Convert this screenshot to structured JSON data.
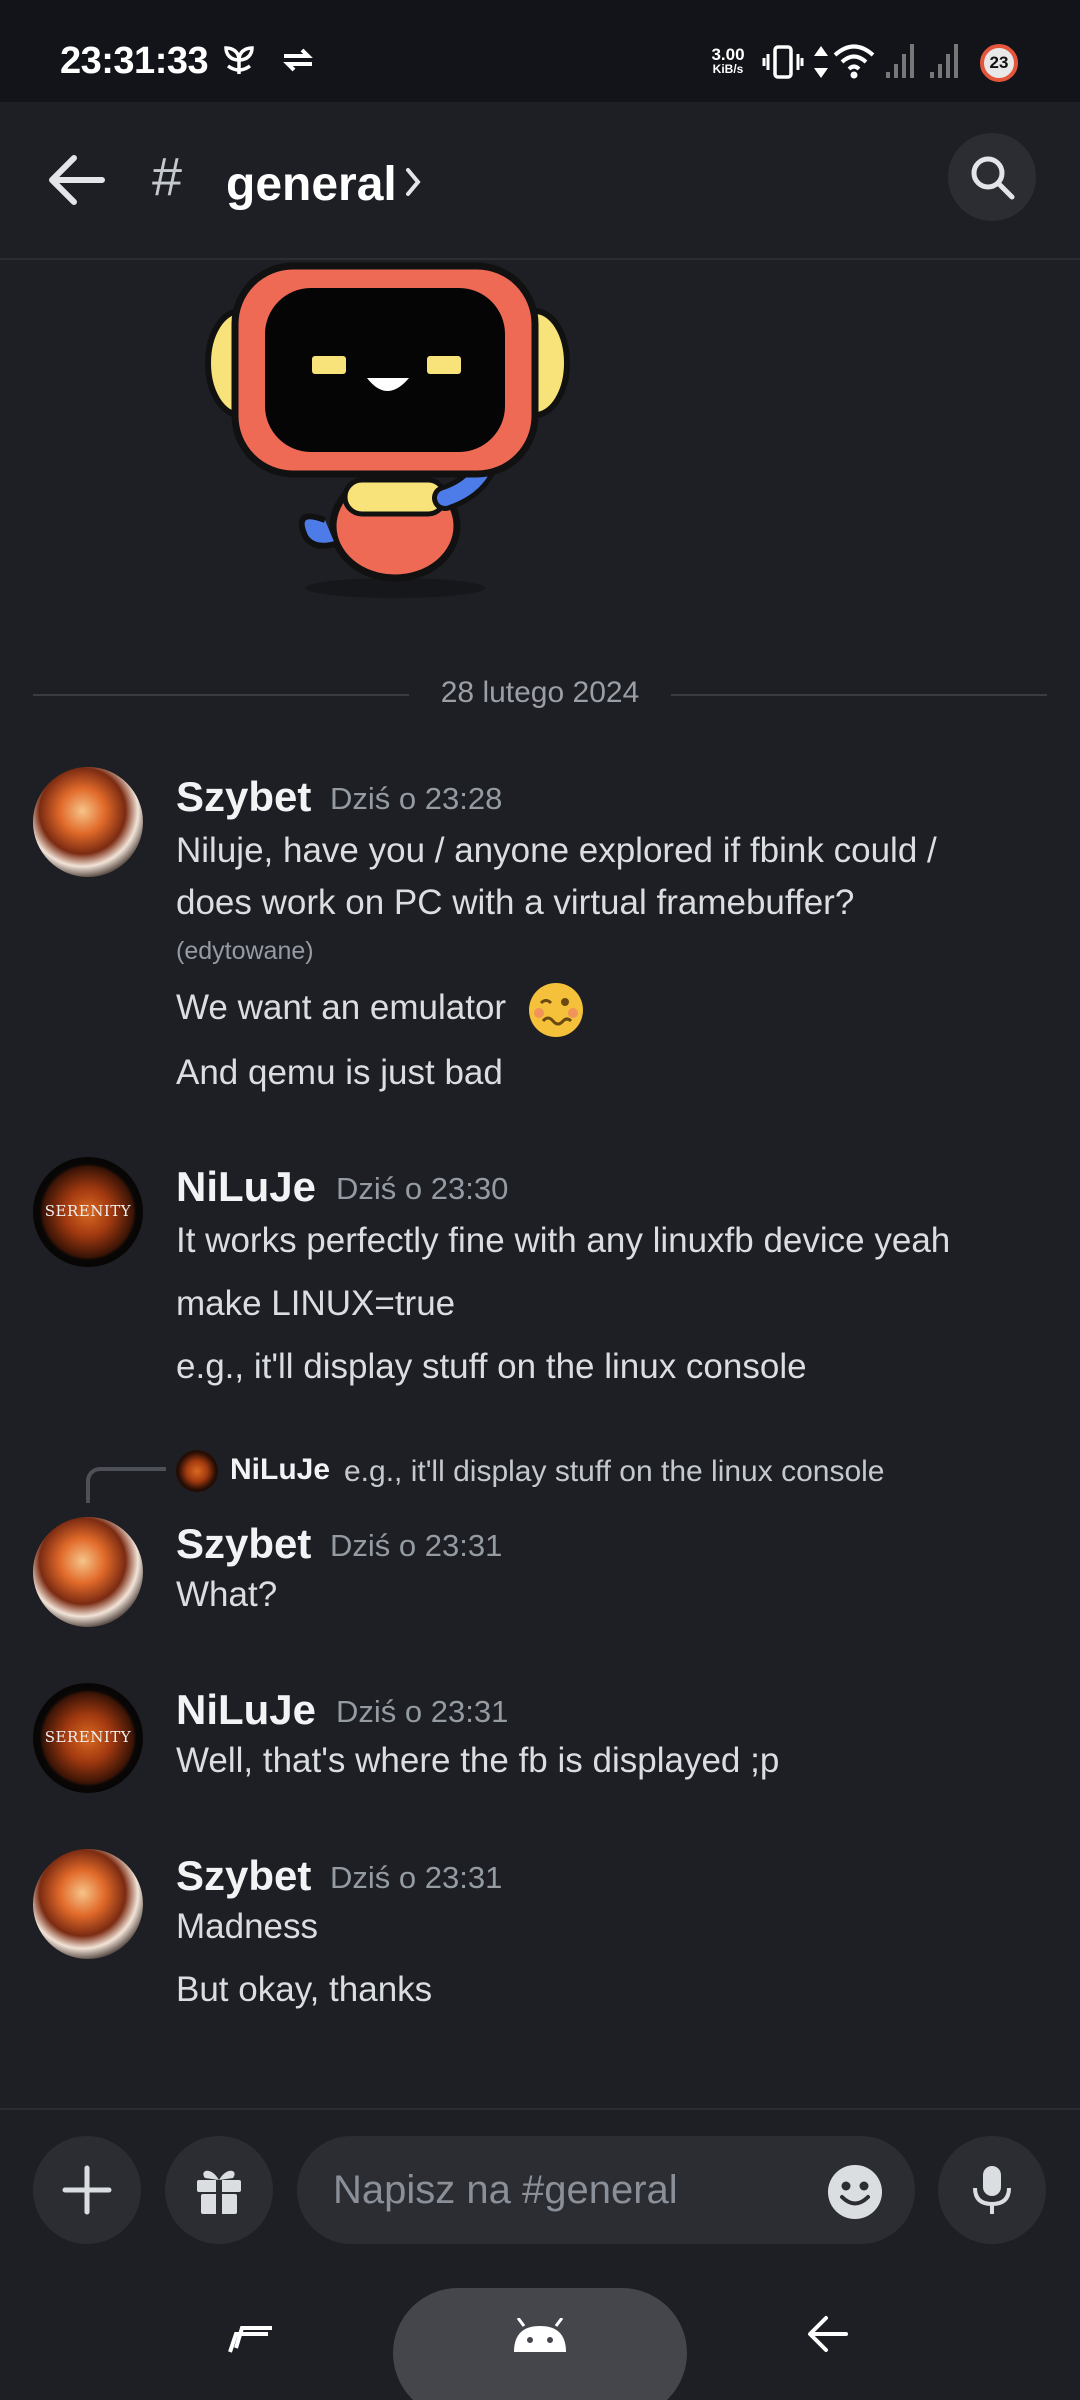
{
  "status_bar": {
    "time": "23:31:33",
    "net_speed_value": "3.00",
    "net_speed_unit": "KiB/s",
    "battery_level": "23"
  },
  "header": {
    "channel_prefix": "#",
    "channel_name": "general"
  },
  "divider": {
    "date": "28 lutego 2024"
  },
  "messages": [
    {
      "author": "Szybet",
      "time": "Dziś o 23:28",
      "lines": [
        "Niluje, have you / anyone explored if fbink could /",
        "does work on PC with a virtual framebuffer?",
        "We want an emulator",
        "And qemu is just bad"
      ],
      "edited_label": "(edytowane)"
    },
    {
      "author": "NiLuJe",
      "time": "Dziś o 23:30",
      "avatar_text": "SERENITY",
      "lines": [
        "It works perfectly fine with any linuxfb device yeah",
        "make LINUX=true",
        "e.g., it'll display stuff on the linux console"
      ]
    },
    {
      "reply_to": {
        "author": "NiLuJe",
        "text": "e.g., it'll display stuff on the linux console"
      },
      "author": "Szybet",
      "time": "Dziś o 23:31",
      "lines": [
        "What?"
      ]
    },
    {
      "author": "NiLuJe",
      "time": "Dziś o 23:31",
      "avatar_text": "SERENITY",
      "lines": [
        "Well, that's where the fb is displayed ;p"
      ]
    },
    {
      "author": "Szybet",
      "time": "Dziś o 23:31",
      "lines": [
        "Madness",
        "But okay, thanks"
      ]
    }
  ],
  "composer": {
    "placeholder": "Napisz na #general"
  },
  "icons": {
    "back": "arrow-left-icon",
    "search": "search-icon",
    "add": "plus-icon",
    "gift": "gift-icon",
    "emoji": "emoji-icon",
    "mic": "microphone-icon",
    "home": "android-icon"
  },
  "colors": {
    "background": "#1e1f24",
    "status_bar": "#131419",
    "surface": "#2b2d33",
    "text_primary": "#f2f3f5",
    "text_muted": "#959ba3",
    "emoji_yellow": "#f6c13a"
  }
}
